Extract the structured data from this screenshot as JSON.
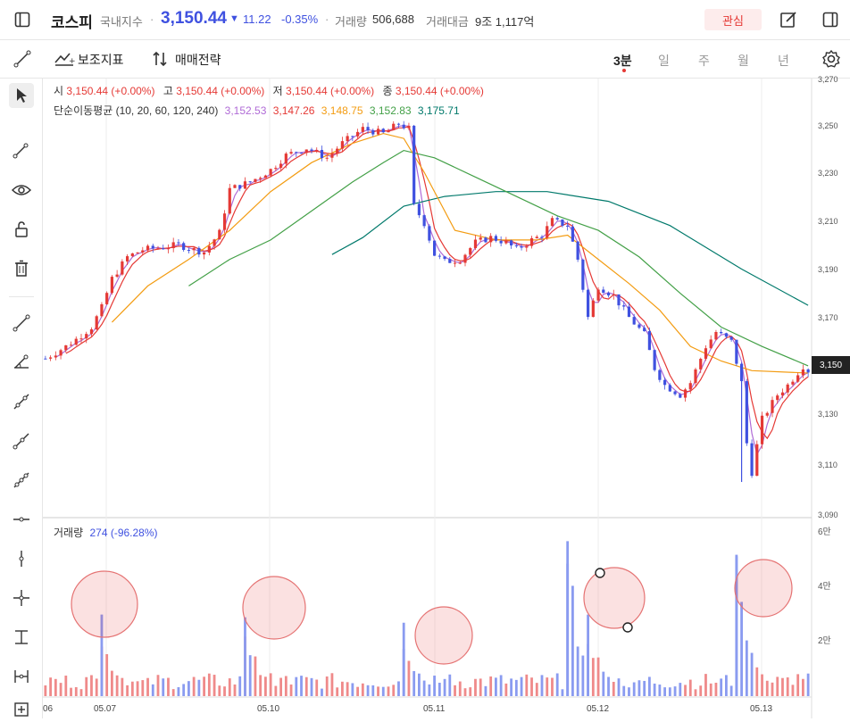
{
  "header": {
    "name": "코스피",
    "category": "국내지수",
    "sep": "·",
    "price": "3,150.44",
    "change_arrow": "▼",
    "change": "11.22",
    "change_pct": "-0.35%",
    "volume_label": "거래량",
    "volume": "506,688",
    "amount_label": "거래대금",
    "amount": "9조 1,117억",
    "watch_label": "관심"
  },
  "toolbar": {
    "indicator_label": "보조지표",
    "strategy_label": "매매전략",
    "timeframes": [
      "3분",
      "일",
      "주",
      "월",
      "년"
    ],
    "active_timeframe": "3분"
  },
  "ohlc": {
    "open_label": "시",
    "open": "3,150.44 (+0.00%)",
    "high_label": "고",
    "high": "3,150.44 (+0.00%)",
    "low_label": "저",
    "low": "3,150.44 (+0.00%)",
    "close_label": "종",
    "close": "3,150.44 (+0.00%)"
  },
  "ma": {
    "label": "단순이동평균 (10, 20, 60, 120, 240)",
    "values": [
      "3,152.53",
      "3,147.26",
      "3,148.75",
      "3,152.83",
      "3,175.71"
    ],
    "colors": [
      "#b06bd6",
      "#e53935",
      "#f39c12",
      "#43a047",
      "#00796b"
    ]
  },
  "volume_panel": {
    "label": "거래량",
    "value": "274 (-96.28%)",
    "y_ticks": [
      "6만",
      "4만",
      "2만"
    ]
  },
  "colors": {
    "up": "#e53935",
    "down": "#3f51e0",
    "accent": "#e53935"
  },
  "chart_data": {
    "type": "candlestick",
    "y_ticks": [
      3270,
      3250,
      3230,
      3210,
      3190,
      3170,
      3150,
      3130,
      3110,
      3090
    ],
    "y_tick_labels": [
      "3,270",
      "3,250",
      "3,230",
      "3,210",
      "3,190",
      "3,170",
      "3,150",
      "3,130",
      "3,110",
      "3,090"
    ],
    "ylim": [
      3090,
      3270
    ],
    "current_price_label": "3,150",
    "x_labels": [
      "06",
      "05.07",
      "05.10",
      "05.11",
      "05.12",
      "05.13"
    ],
    "price_path": [
      [
        0,
        3155
      ],
      [
        4,
        3160
      ],
      [
        6,
        3163
      ],
      [
        9,
        3168
      ],
      [
        11,
        3176
      ],
      [
        13,
        3188
      ],
      [
        16,
        3197
      ],
      [
        19,
        3200
      ],
      [
        23,
        3201
      ],
      [
        26,
        3202
      ],
      [
        29,
        3200
      ],
      [
        31,
        3199
      ],
      [
        34,
        3207
      ],
      [
        36,
        3225
      ],
      [
        40,
        3228
      ],
      [
        44,
        3233
      ],
      [
        47,
        3239
      ],
      [
        51,
        3242
      ],
      [
        55,
        3238
      ],
      [
        58,
        3244
      ],
      [
        62,
        3250
      ],
      [
        66,
        3248
      ],
      [
        69,
        3252
      ],
      [
        71,
        3250
      ],
      [
        72,
        3218
      ],
      [
        74,
        3211
      ],
      [
        76,
        3198
      ],
      [
        78,
        3195
      ],
      [
        81,
        3196
      ],
      [
        84,
        3203
      ],
      [
        87,
        3205
      ],
      [
        90,
        3203
      ],
      [
        92,
        3200
      ],
      [
        95,
        3204
      ],
      [
        97,
        3206
      ],
      [
        99,
        3212
      ],
      [
        102,
        3210
      ],
      [
        104,
        3196
      ],
      [
        106,
        3172
      ],
      [
        108,
        3185
      ],
      [
        111,
        3181
      ],
      [
        114,
        3172
      ],
      [
        117,
        3165
      ],
      [
        119,
        3151
      ],
      [
        121,
        3144
      ],
      [
        124,
        3140
      ],
      [
        126,
        3145
      ],
      [
        129,
        3160
      ],
      [
        131,
        3166
      ],
      [
        134,
        3162
      ],
      [
        136,
        3145
      ],
      [
        137,
        3120
      ],
      [
        138,
        3108
      ],
      [
        140,
        3130
      ],
      [
        143,
        3140
      ],
      [
        145,
        3144
      ],
      [
        148,
        3152
      ],
      [
        149,
        3150
      ]
    ],
    "ma_paths": [
      {
        "period": 120,
        "points": [
          [
            56,
            3198
          ],
          [
            62,
            3205
          ],
          [
            70,
            3218
          ],
          [
            78,
            3222
          ],
          [
            88,
            3224
          ],
          [
            98,
            3224
          ],
          [
            110,
            3220
          ],
          [
            122,
            3210
          ],
          [
            136,
            3192
          ],
          [
            149,
            3177
          ]
        ]
      },
      {
        "period": 60,
        "points": [
          [
            28,
            3185
          ],
          [
            36,
            3196
          ],
          [
            44,
            3204
          ],
          [
            52,
            3216
          ],
          [
            60,
            3228
          ],
          [
            66,
            3236
          ],
          [
            70,
            3241
          ],
          [
            76,
            3238
          ],
          [
            84,
            3230
          ],
          [
            92,
            3222
          ],
          [
            100,
            3214
          ],
          [
            108,
            3208
          ],
          [
            116,
            3197
          ],
          [
            124,
            3182
          ],
          [
            132,
            3168
          ],
          [
            140,
            3160
          ],
          [
            149,
            3152
          ]
        ]
      },
      {
        "period": 240,
        "points": [
          [
            13,
            3170
          ],
          [
            20,
            3185
          ],
          [
            28,
            3196
          ],
          [
            36,
            3208
          ],
          [
            44,
            3224
          ],
          [
            52,
            3236
          ],
          [
            60,
            3244
          ],
          [
            66,
            3248
          ],
          [
            70,
            3246
          ],
          [
            74,
            3232
          ],
          [
            80,
            3208
          ],
          [
            88,
            3204
          ],
          [
            96,
            3204
          ],
          [
            102,
            3206
          ],
          [
            108,
            3196
          ],
          [
            114,
            3186
          ],
          [
            120,
            3175
          ],
          [
            126,
            3160
          ],
          [
            132,
            3154
          ],
          [
            138,
            3150
          ],
          [
            149,
            3149
          ]
        ]
      }
    ],
    "volume_spikes": [
      [
        11,
        30000
      ],
      [
        39,
        29000
      ],
      [
        70,
        27000
      ],
      [
        102,
        57000
      ],
      [
        106,
        30000
      ],
      [
        135,
        52000
      ]
    ]
  }
}
